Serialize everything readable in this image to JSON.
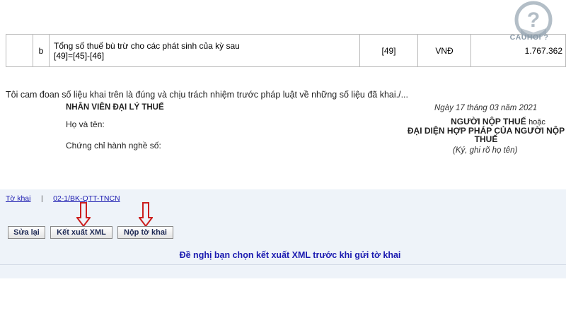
{
  "table_row": {
    "letter": "b",
    "desc_line1": "Tổng số thuế bù trừ cho các phát sinh của kỳ sau",
    "desc_line2": "[49]=[45]-[46]",
    "code": "[49]",
    "unit": "VNĐ",
    "amount": "1.767.362"
  },
  "declaration": {
    "commitment": "Tôi cam đoan số liệu khai trên là đúng và chịu trách nhiệm trước pháp luật về những số liệu đã khai./...",
    "agent_title": "NHÂN VIÊN ĐẠI LÝ THUẾ",
    "name_label": "Họ và tên:",
    "certificate_label": "Chứng chỉ hành nghề số:",
    "date": "Ngày 17 tháng 03 năm 2021",
    "taxpayer_title": "NGƯỜI NỘP THUẾ",
    "taxpayer_or": "hoặc",
    "rep_line1": "ĐẠI DIỆN HỢP PHÁP CỦA NGƯỜI NỘP",
    "rep_line2": "THUẾ",
    "sign_note": "(Ký, ghi rõ họ tên)"
  },
  "tabs": {
    "to_khai": "Tờ khai",
    "separator": "|",
    "appendix": "02-1/BK-QTT-TNCN"
  },
  "buttons": {
    "edit": "Sửa lại",
    "export_xml": "Kết xuất XML",
    "submit": "Nộp tờ khai"
  },
  "notice": "Đề nghị bạn chọn kết xuất XML trước khi gửi tờ khai",
  "watermark": {
    "text": "CAUHOI ?",
    "symbol": "?"
  },
  "colors": {
    "link": "#1a1ab0",
    "arrow": "#cc1f1f",
    "panel": "#eef3f9"
  }
}
